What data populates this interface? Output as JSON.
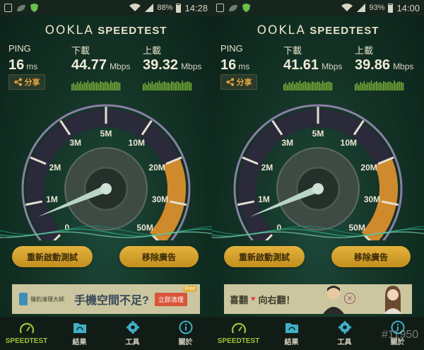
{
  "left": {
    "status": {
      "battery": "88%",
      "time": "14:28"
    },
    "logo": {
      "brand": "OOKLA",
      "product": "SPEEDTEST"
    },
    "ping": {
      "label": "PING",
      "value": "16",
      "unit": "ms"
    },
    "download": {
      "label": "下載",
      "value": "44.77",
      "unit": "Mbps"
    },
    "upload": {
      "label": "上載",
      "value": "39.32",
      "unit": "Mbps"
    },
    "share_label": "分享",
    "gauge_labels": [
      "0",
      "1M",
      "2M",
      "3M",
      "5M",
      "10M",
      "20M",
      "30M",
      "50M"
    ],
    "needle_value": 0.7,
    "buttons": {
      "restart": "重新啟動測試",
      "remove_ads": "移除廣告"
    },
    "ad": {
      "title": "獵豹清理大師",
      "headline": "手機空間不足?",
      "cta": "立即清理",
      "badge": "Free"
    },
    "nav": [
      "SPEEDTEST",
      "結果",
      "工具",
      "關於"
    ]
  },
  "right": {
    "status": {
      "battery": "93%",
      "time": "14:00"
    },
    "logo": {
      "brand": "OOKLA",
      "product": "SPEEDTEST"
    },
    "ping": {
      "label": "PING",
      "value": "16",
      "unit": "ms"
    },
    "download": {
      "label": "下載",
      "value": "41.61",
      "unit": "Mbps"
    },
    "upload": {
      "label": "上載",
      "value": "39.86",
      "unit": "Mbps"
    },
    "share_label": "分享",
    "gauge_labels": [
      "0",
      "1M",
      "2M",
      "3M",
      "5M",
      "10M",
      "20M",
      "30M",
      "50M"
    ],
    "needle_value": 0.7,
    "buttons": {
      "restart": "重新啟動測試",
      "remove_ads": "移除廣告"
    },
    "ad": {
      "text1": "喜翻",
      "text2": "向右翻！"
    },
    "nav": [
      "SPEEDTEST",
      "結果",
      "工具",
      "關於"
    ]
  },
  "watermark": "#11950",
  "colors": {
    "accent": "#e3b23c",
    "gauge_fill": "#e0952c",
    "active_nav": "#9ac43a",
    "spark": "#7fb83a"
  }
}
